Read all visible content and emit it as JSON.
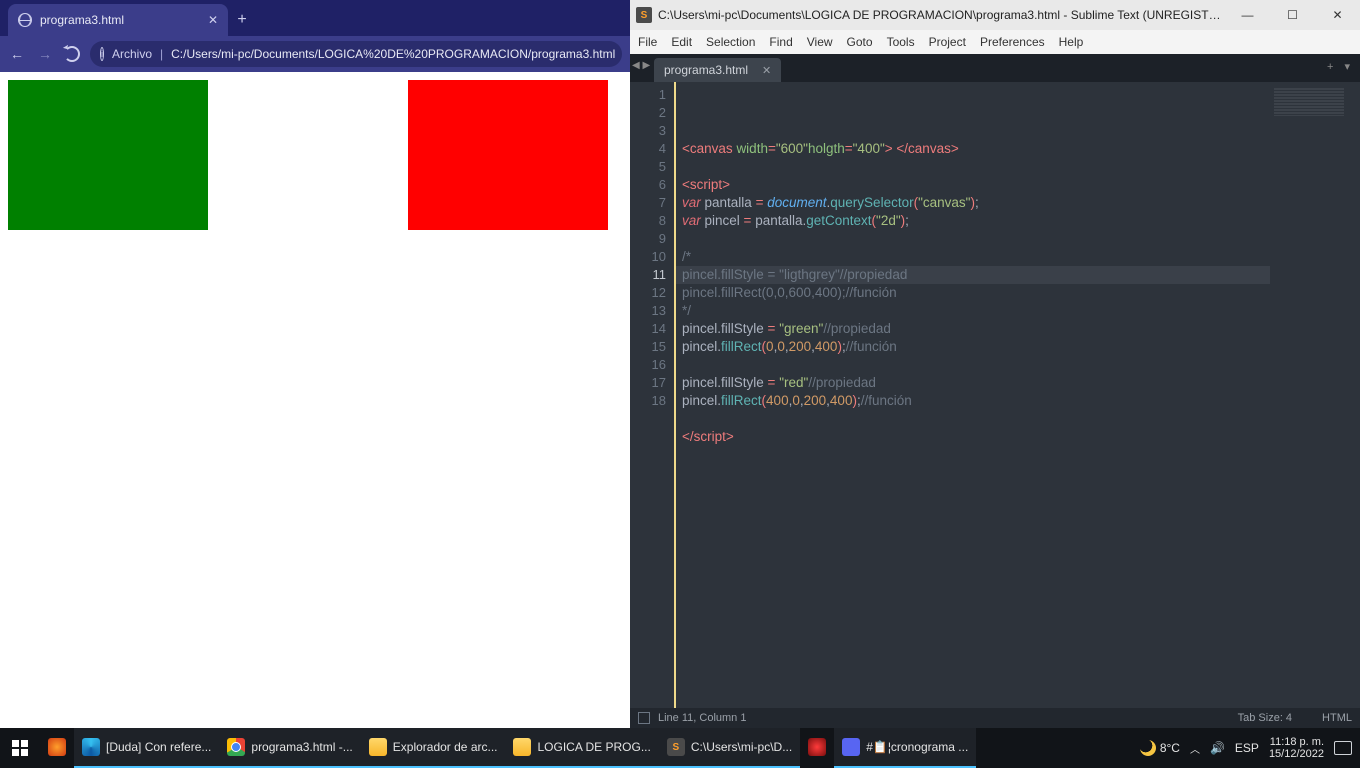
{
  "chrome": {
    "tab_title": "programa3.html",
    "omnibox_label": "Archivo",
    "url": "C:/Users/mi-pc/Documents/LOGICA%20DE%20PROGRAMACION/programa3.html"
  },
  "sublime": {
    "title": "C:\\Users\\mi-pc\\Documents\\LOGICA DE PROGRAMACION\\programa3.html - Sublime Text (UNREGISTER...",
    "menu": [
      "File",
      "Edit",
      "Selection",
      "Find",
      "View",
      "Goto",
      "Tools",
      "Project",
      "Preferences",
      "Help"
    ],
    "tab": "programa3.html",
    "status_left": "Line 11, Column 1",
    "status_tabsize": "Tab Size: 4",
    "status_lang": "HTML",
    "gutter": [
      "1",
      "2",
      "3",
      "4",
      "5",
      "6",
      "7",
      "8",
      "9",
      "10",
      "11",
      "12",
      "13",
      "14",
      "15",
      "16",
      "17",
      "18"
    ],
    "active_line_index": 10,
    "code_lines": [
      [
        [
          "p",
          "<"
        ],
        [
          "tg",
          "canvas"
        ],
        [
          "id",
          " "
        ],
        [
          "at",
          "width"
        ],
        [
          "p",
          "="
        ],
        [
          "st",
          "\"600\""
        ],
        [
          "at",
          "holgth"
        ],
        [
          "p",
          "="
        ],
        [
          "st",
          "\"400\""
        ],
        [
          "p",
          ">"
        ],
        [
          "id",
          " "
        ],
        [
          "p",
          "</"
        ],
        [
          "tg",
          "canvas"
        ],
        [
          "p",
          ">"
        ]
      ],
      [],
      [
        [
          "p",
          "<"
        ],
        [
          "tg",
          "script"
        ],
        [
          "p",
          ">"
        ]
      ],
      [
        [
          "kw",
          "var"
        ],
        [
          "id",
          " pantalla "
        ],
        [
          "p",
          "="
        ],
        [
          "id",
          " "
        ],
        [
          "vr",
          "document"
        ],
        [
          "id",
          "."
        ],
        [
          "fn",
          "querySelector"
        ],
        [
          "p",
          "("
        ],
        [
          "st",
          "\"canvas\""
        ],
        [
          "p",
          ")"
        ],
        [
          "id",
          ";"
        ]
      ],
      [
        [
          "kw",
          "var"
        ],
        [
          "id",
          " pincel "
        ],
        [
          "p",
          "="
        ],
        [
          "id",
          " pantalla."
        ],
        [
          "fn",
          "getContext"
        ],
        [
          "p",
          "("
        ],
        [
          "st",
          "\"2d\""
        ],
        [
          "p",
          ")"
        ],
        [
          "id",
          ";"
        ]
      ],
      [],
      [
        [
          "cm",
          "/*"
        ]
      ],
      [
        [
          "cm",
          "pincel.fillStyle = \"ligthgrey\"//propiedad"
        ]
      ],
      [
        [
          "cm",
          "pincel.fillRect(0,0,600,400);//función"
        ]
      ],
      [
        [
          "cm",
          "*/"
        ]
      ],
      [
        [
          "id",
          "pincel.fillStyle "
        ],
        [
          "p",
          "="
        ],
        [
          "id",
          " "
        ],
        [
          "st",
          "\"green\""
        ],
        [
          "cm",
          "//propiedad"
        ]
      ],
      [
        [
          "id",
          "pincel."
        ],
        [
          "fn",
          "fillRect"
        ],
        [
          "p",
          "("
        ],
        [
          "nm",
          "0"
        ],
        [
          "id",
          ","
        ],
        [
          "nm",
          "0"
        ],
        [
          "id",
          ","
        ],
        [
          "nm",
          "200"
        ],
        [
          "id",
          ","
        ],
        [
          "nm",
          "400"
        ],
        [
          "p",
          ")"
        ],
        [
          "id",
          ";"
        ],
        [
          "cm",
          "//función"
        ]
      ],
      [],
      [
        [
          "id",
          "pincel.fillStyle "
        ],
        [
          "p",
          "="
        ],
        [
          "id",
          " "
        ],
        [
          "st",
          "\"red\""
        ],
        [
          "cm",
          "//propiedad"
        ]
      ],
      [
        [
          "id",
          "pincel."
        ],
        [
          "fn",
          "fillRect"
        ],
        [
          "p",
          "("
        ],
        [
          "nm",
          "400"
        ],
        [
          "id",
          ","
        ],
        [
          "nm",
          "0"
        ],
        [
          "id",
          ","
        ],
        [
          "nm",
          "200"
        ],
        [
          "id",
          ","
        ],
        [
          "nm",
          "400"
        ],
        [
          "p",
          ")"
        ],
        [
          "id",
          ";"
        ],
        [
          "cm",
          "//función"
        ]
      ],
      [],
      [
        [
          "p",
          "</"
        ],
        [
          "tg",
          "script"
        ],
        [
          "p",
          ">"
        ]
      ],
      []
    ]
  },
  "taskbar": {
    "items": [
      {
        "icon": "ff-ico",
        "label": ""
      },
      {
        "icon": "edge-ico",
        "label": "[Duda] Con refere..."
      },
      {
        "icon": "chrome-ico",
        "label": "programa3.html -..."
      },
      {
        "icon": "folder-ico",
        "label": "Explorador de arc..."
      },
      {
        "icon": "folder-ico",
        "label": "LOGICA DE PROG..."
      },
      {
        "icon": "subl-ico",
        "label": "C:\\Users\\mi-pc\\D..."
      },
      {
        "icon": "boost-ico",
        "label": ""
      },
      {
        "icon": "disc-ico",
        "label": "#📋¦cronograma ..."
      }
    ],
    "weather": "8°C",
    "lang": "ESP",
    "time": "11:18 p. m.",
    "date": "15/12/2022"
  }
}
